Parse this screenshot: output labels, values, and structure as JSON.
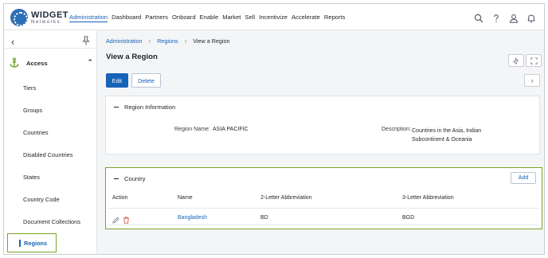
{
  "brand": {
    "name": "WIDGET",
    "sub": "Networks"
  },
  "nav": [
    "Administration",
    "Dashboard",
    "Partners",
    "Onboard",
    "Enable",
    "Market",
    "Sell",
    "Incentivize",
    "Accelerate",
    "Reports"
  ],
  "nav_active": "Administration",
  "top_icons": [
    "search-icon",
    "help-icon",
    "user-icon",
    "notification-icon"
  ],
  "sidebar": {
    "section": "Access",
    "items": [
      "Tiers",
      "Groups",
      "Countries",
      "Disabled Countries",
      "States",
      "Country Code",
      "Document Collections"
    ],
    "active_item": "Regions"
  },
  "breadcrumb": {
    "root": "Administration",
    "parent": "Regions",
    "current": "View a Region"
  },
  "page": {
    "title": "View a Region",
    "edit_label": "Edit",
    "delete_label": "Delete"
  },
  "region_info": {
    "title": "Region Information",
    "name_label": "Region Name:",
    "name_value": "ASIA PACIFIC",
    "description_label": "Description:",
    "description_value": "Countries in the Asia, Indian Subcontinent & Oceania"
  },
  "country": {
    "title": "Country",
    "add_label": "Add",
    "columns": [
      "Action",
      "Name",
      "2-Letter Abbreviation",
      "3-Letter Abbreviation"
    ],
    "rows": [
      {
        "name": "Bangladesh",
        "abbr2": "BD",
        "abbr3": "BGD"
      }
    ]
  },
  "colors": {
    "accent": "#1763b8",
    "highlight": "#7aa32a",
    "delete": "#d9534f"
  }
}
